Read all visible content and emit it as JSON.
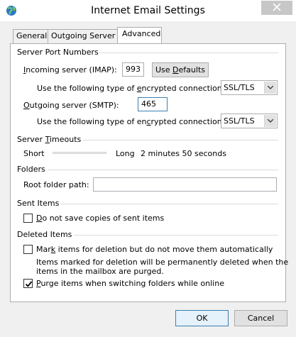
{
  "window": {
    "title": "Internet Email Settings"
  },
  "tabs": {
    "general": "General",
    "outgoing": "Outgoing Server",
    "advanced": "Advanced"
  },
  "server_ports": {
    "title": "Server Port Numbers",
    "incoming_label": "Incoming server (IMAP):",
    "incoming_value": "993",
    "use_defaults": "Use Defaults",
    "enc_label_in": "Use the following type of encrypted connection:",
    "enc_value_in": "SSL/TLS",
    "outgoing_label": "Outgoing server (SMTP):",
    "outgoing_value": "465",
    "enc_label_out": "Use the following type of encrypted connection:",
    "enc_value_out": "SSL/TLS"
  },
  "timeouts": {
    "title": "Server Timeouts",
    "short": "Short",
    "long": "Long",
    "value_text": "2 minutes 50 seconds"
  },
  "folders": {
    "title": "Folders",
    "root_label": "Root folder path:",
    "root_value": ""
  },
  "sent_items": {
    "title": "Sent Items",
    "no_copies": "Do not save copies of sent items",
    "no_copies_checked": false
  },
  "deleted_items": {
    "title": "Deleted Items",
    "mark_items": "Mark items for deletion but do not move them automatically",
    "mark_items_checked": false,
    "note_line1": "Items marked for deletion will be permanently deleted when the",
    "note_line2": "items in the mailbox are purged.",
    "purge": "Purge items when switching folders while online",
    "purge_checked": true
  },
  "footer": {
    "ok": "OK",
    "cancel": "Cancel"
  },
  "colors": {
    "accent": "#3c7fb1",
    "window_bg": "#f0f0f0",
    "close_bg": "#c7c7c7"
  }
}
